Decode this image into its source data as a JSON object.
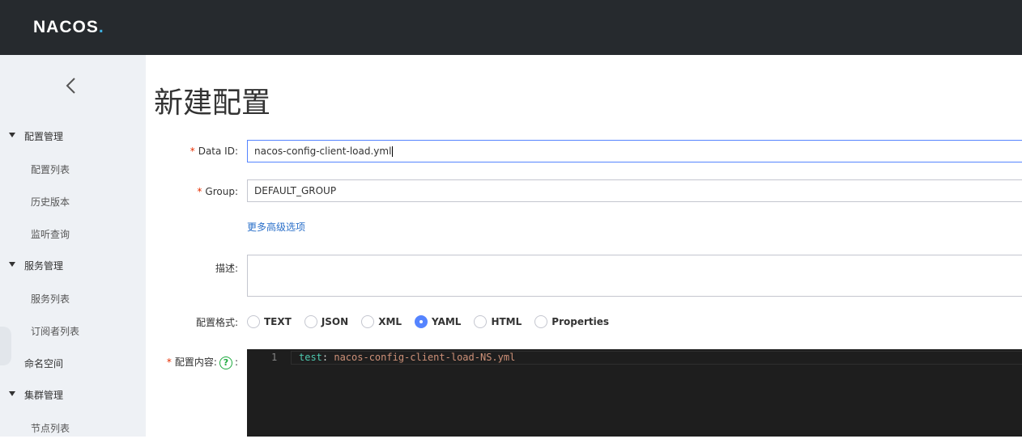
{
  "header": {
    "logo_main": "NACOS",
    "logo_dot": "."
  },
  "sidebar": {
    "groups": [
      {
        "label": "配置管理",
        "items": [
          "配置列表",
          "历史版本",
          "监听查询"
        ]
      },
      {
        "label": "服务管理",
        "items": [
          "服务列表",
          "订阅者列表"
        ]
      },
      {
        "label": "集群管理",
        "items": [
          "节点列表"
        ]
      }
    ],
    "namespace_label": "命名空间"
  },
  "page": {
    "title": "新建配置"
  },
  "form": {
    "required_mark": "*",
    "data_id_label": "Data ID:",
    "data_id_value": "nacos-config-client-load.yml",
    "group_label": "Group:",
    "group_value": "DEFAULT_GROUP",
    "advanced_link": "更多高级选项",
    "desc_label": "描述:",
    "format_label": "配置格式:",
    "formats": [
      "TEXT",
      "JSON",
      "XML",
      "YAML",
      "HTML",
      "Properties"
    ],
    "selected_format": "YAML",
    "content_label": "配置内容:",
    "help_glyph": "?",
    "content_colon": ":"
  },
  "editor": {
    "line_number": "1",
    "key": "test",
    "sep": ": ",
    "value": "nacos-config-client-load-NS.yml"
  },
  "colors": {
    "topbar": "#262a2e",
    "sidebar": "#eef1f5",
    "accent": "#5584ff",
    "link": "#2a6fc9",
    "required": "#e62e00",
    "editor_bg": "#1e1e1e"
  }
}
